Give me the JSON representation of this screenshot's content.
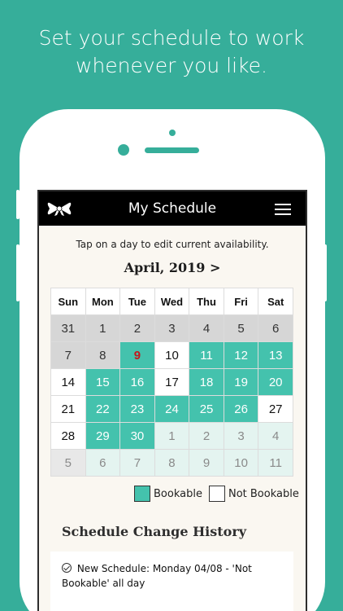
{
  "headline": {
    "line1": "Set your schedule to work",
    "line2": "whenever you like."
  },
  "nav": {
    "title": "My Schedule",
    "logo_icon": "bow-icon",
    "menu_icon": "hamburger-menu-icon"
  },
  "hint": "Tap on a day to edit current availability.",
  "month_label": "April, 2019 >",
  "calendar": {
    "weekdays": [
      "Sun",
      "Mon",
      "Tue",
      "Wed",
      "Thu",
      "Fri",
      "Sat"
    ],
    "weeks": [
      [
        {
          "d": "31",
          "s": "past"
        },
        {
          "d": "1",
          "s": "past"
        },
        {
          "d": "2",
          "s": "past"
        },
        {
          "d": "3",
          "s": "past"
        },
        {
          "d": "4",
          "s": "past"
        },
        {
          "d": "5",
          "s": "past"
        },
        {
          "d": "6",
          "s": "past"
        }
      ],
      [
        {
          "d": "7",
          "s": "past"
        },
        {
          "d": "8",
          "s": "past"
        },
        {
          "d": "9",
          "s": "today"
        },
        {
          "d": "10",
          "s": "nb"
        },
        {
          "d": "11",
          "s": "book"
        },
        {
          "d": "12",
          "s": "book"
        },
        {
          "d": "13",
          "s": "book"
        }
      ],
      [
        {
          "d": "14",
          "s": "nb"
        },
        {
          "d": "15",
          "s": "book"
        },
        {
          "d": "16",
          "s": "book"
        },
        {
          "d": "17",
          "s": "nb"
        },
        {
          "d": "18",
          "s": "book"
        },
        {
          "d": "19",
          "s": "book"
        },
        {
          "d": "20",
          "s": "book"
        }
      ],
      [
        {
          "d": "21",
          "s": "nb"
        },
        {
          "d": "22",
          "s": "book"
        },
        {
          "d": "23",
          "s": "book"
        },
        {
          "d": "24",
          "s": "book"
        },
        {
          "d": "25",
          "s": "book"
        },
        {
          "d": "26",
          "s": "book"
        },
        {
          "d": "27",
          "s": "nb"
        }
      ],
      [
        {
          "d": "28",
          "s": "nb"
        },
        {
          "d": "29",
          "s": "book"
        },
        {
          "d": "30",
          "s": "book"
        },
        {
          "d": "1",
          "s": "next"
        },
        {
          "d": "2",
          "s": "next"
        },
        {
          "d": "3",
          "s": "next"
        },
        {
          "d": "4",
          "s": "next"
        }
      ],
      [
        {
          "d": "5",
          "s": "nextpast"
        },
        {
          "d": "6",
          "s": "next"
        },
        {
          "d": "7",
          "s": "next"
        },
        {
          "d": "8",
          "s": "next"
        },
        {
          "d": "9",
          "s": "next"
        },
        {
          "d": "10",
          "s": "next"
        },
        {
          "d": "11",
          "s": "next"
        }
      ]
    ]
  },
  "legend": {
    "bookable": "Bookable",
    "not_bookable": "Not Bookable"
  },
  "history": {
    "title": "Schedule Change History",
    "entry_line1": "New Schedule: Monday 04/08 - 'Not",
    "entry_line2": "Bookable' all day"
  },
  "colors": {
    "background": "#36ae9a",
    "bookable": "#44c2ad",
    "today_text": "#c4161c",
    "nav": "#000000"
  }
}
